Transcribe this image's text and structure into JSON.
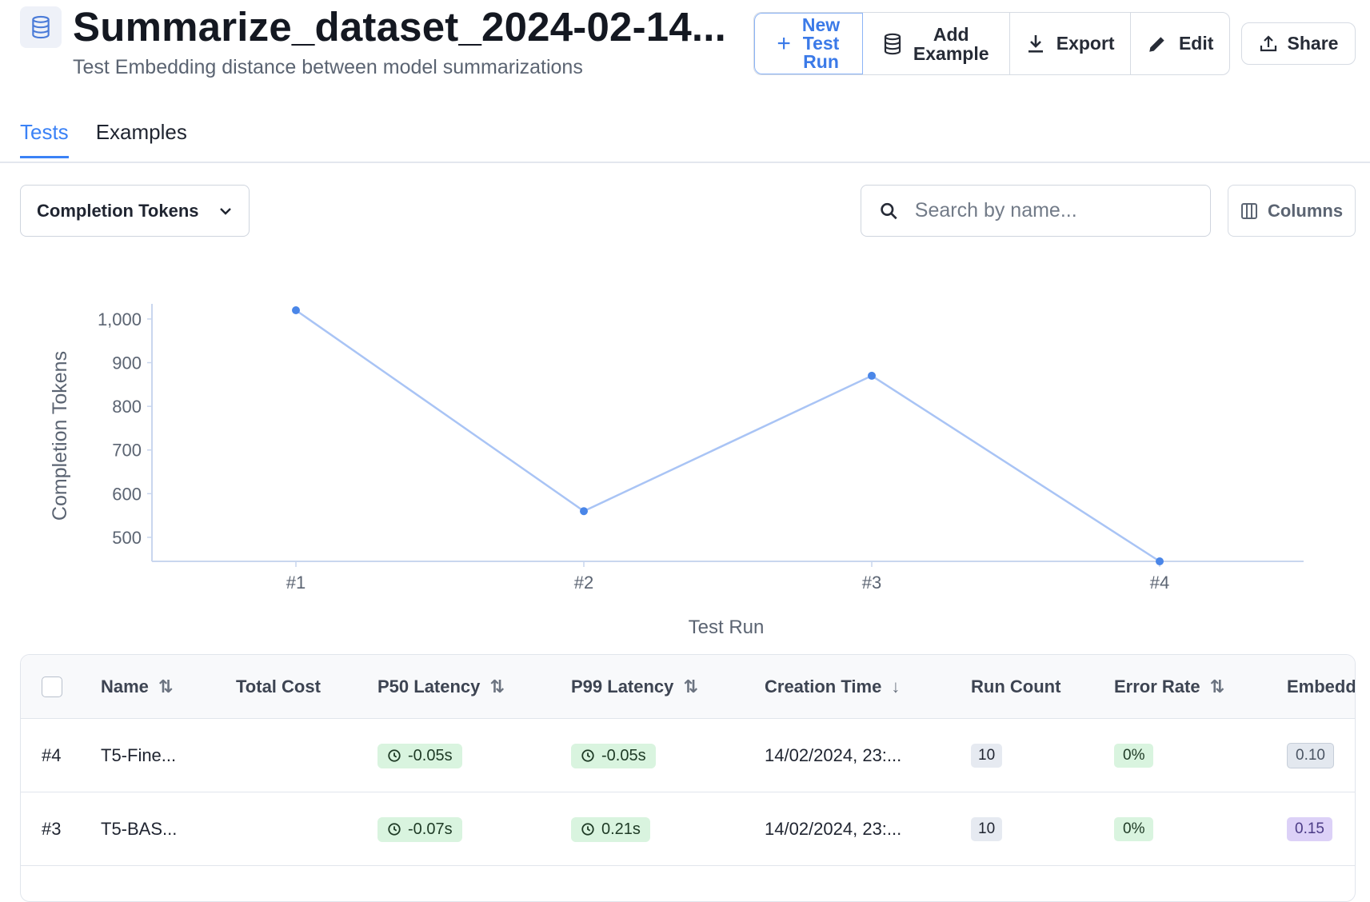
{
  "header": {
    "title": "Summarize_dataset_2024-02-14...",
    "subtitle": "Test Embedding distance between model summarizations",
    "dataset_icon": "database-icon"
  },
  "actions": {
    "new_test_run": "New Test Run",
    "new_test_run_lines": [
      "New",
      "Test",
      "Run"
    ],
    "add_example_lines": [
      "Add",
      "Example"
    ],
    "export": "Export",
    "edit": "Edit",
    "share": "Share"
  },
  "tabs": [
    {
      "label": "Tests",
      "active": true
    },
    {
      "label": "Examples",
      "active": false
    }
  ],
  "controls": {
    "metric_selected": "Completion Tokens",
    "search_placeholder": "Search by name...",
    "columns_label": "Columns"
  },
  "chart_data": {
    "type": "line",
    "categories": [
      "#1",
      "#2",
      "#3",
      "#4"
    ],
    "values": [
      1020,
      560,
      870,
      445
    ],
    "xlabel": "Test Run",
    "ylabel": "Completion Tokens",
    "yticks": [
      "500",
      "600",
      "700",
      "800",
      "900",
      "1,000"
    ],
    "ytick_values": [
      500,
      600,
      700,
      800,
      900,
      1000
    ],
    "ylim": [
      445,
      1020
    ],
    "grid": false,
    "line_color": "#a9c4f5",
    "point_color": "#4a86e8"
  },
  "table": {
    "columns": [
      "Name",
      "Total Cost",
      "P50 Latency",
      "P99 Latency",
      "Creation Time",
      "Run Count",
      "Error Rate",
      "Embedd"
    ],
    "rows": [
      {
        "id": "#4",
        "name": "T5-Fine...",
        "total_cost": "",
        "p50": "-0.05s",
        "p99": "-0.05s",
        "created": "14/02/2024, 23:...",
        "run_count": "10",
        "error_rate": "0%",
        "embedding": "0.10"
      },
      {
        "id": "#3",
        "name": "T5-BAS...",
        "total_cost": "",
        "p50": "-0.07s",
        "p99": "0.21s",
        "created": "14/02/2024, 23:...",
        "run_count": "10",
        "error_rate": "0%",
        "embedding": "0.15"
      }
    ]
  }
}
